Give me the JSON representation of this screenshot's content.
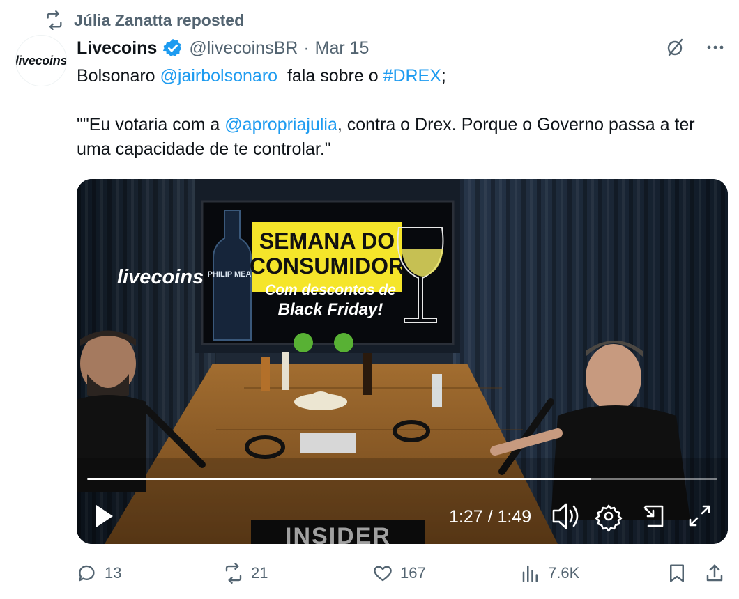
{
  "repost": {
    "text": "Júlia Zanatta reposted"
  },
  "author": {
    "avatar_text": "livecoins",
    "name": "Livecoins",
    "handle": "@livecoinsBR",
    "separator": "·",
    "date": "Mar 15"
  },
  "tweet": {
    "line1_pre": "Bolsonaro ",
    "mention1": "@jairbolsonaro",
    "line1_mid": "  fala sobre o ",
    "hashtag": "#DREX",
    "line1_post": ";",
    "line2_pre": "\"\"Eu votaria com a ",
    "mention2": "@apropriajulia",
    "line2_post": ", contra o Drex. Porque o Governo passa a ter uma capacidade de te controlar.\""
  },
  "video": {
    "watermark": "livecoins",
    "banner_line1": "SEMANA DO",
    "banner_line2": "CONSUMIDOR",
    "banner_line3": "Com descontos de",
    "banner_line4": "Black Friday!",
    "bottle_label": "PHILIP MEAD",
    "table_logo": "INSIDER",
    "time": "1:27 / 1:49",
    "progress": 0.8
  },
  "actions": {
    "replies": "13",
    "reposts": "21",
    "likes": "167",
    "views": "7.6K"
  },
  "colors": {
    "link": "#1d9bf0",
    "secondary": "#536471",
    "verified": "#1d9bf0",
    "banner_yellow": "#f5e52a"
  },
  "icons": {
    "repost": "repost-icon",
    "verified": "verified-badge-icon",
    "grok": "grok-icon",
    "more": "more-icon",
    "reply": "reply-icon",
    "like": "heart-icon",
    "views": "views-icon",
    "bookmark": "bookmark-icon",
    "share": "share-icon",
    "play": "play-icon",
    "volume": "volume-icon",
    "settings": "gear-icon",
    "pip": "pip-icon",
    "fullscreen": "fullscreen-icon"
  }
}
